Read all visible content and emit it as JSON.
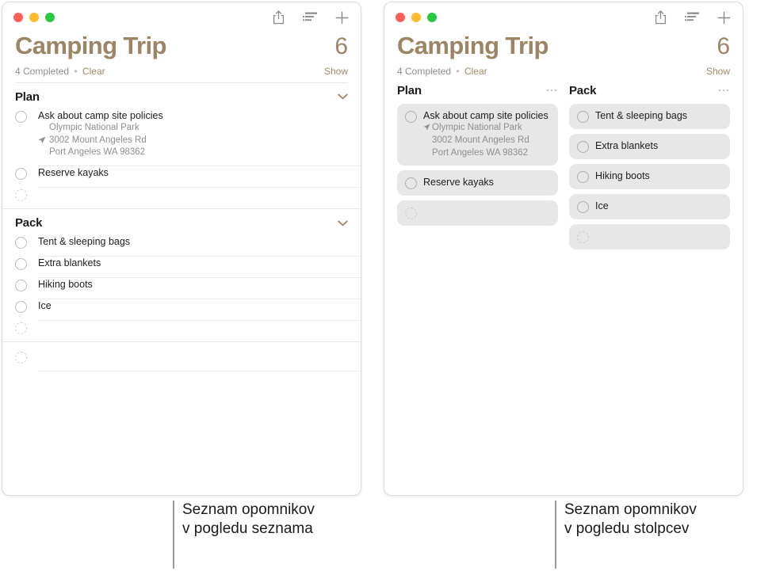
{
  "window_list": {
    "traffic_lights": [
      "close",
      "minimize",
      "zoom"
    ],
    "toolbar": {
      "share_label": "Share",
      "view_label": "List View Options",
      "add_label": "Add Reminder"
    },
    "title": "Camping Trip",
    "count": "6",
    "completed_text": "4 Completed",
    "separator": "•",
    "clear_label": "Clear",
    "show_label": "Show",
    "sections": [
      {
        "name": "Plan",
        "items": [
          {
            "title": "Ask about camp site policies",
            "sub": [
              "Olympic National Park",
              "3002 Mount Angeles Rd",
              "Port Angeles WA 98362"
            ],
            "arrow_on_line": 1
          },
          {
            "title": "Reserve kayaks",
            "sub": []
          },
          {
            "title": "",
            "sub": [],
            "placeholder": true
          }
        ]
      },
      {
        "name": "Pack",
        "items": [
          {
            "title": "Tent & sleeping bags",
            "sub": []
          },
          {
            "title": "Extra blankets",
            "sub": []
          },
          {
            "title": "Hiking boots",
            "sub": []
          },
          {
            "title": "Ice",
            "sub": []
          },
          {
            "title": "",
            "sub": [],
            "placeholder": true
          }
        ]
      }
    ],
    "trailing_placeholder": ""
  },
  "window_columns": {
    "title": "Camping Trip",
    "count": "6",
    "completed_text": "4 Completed",
    "separator": "•",
    "clear_label": "Clear",
    "show_label": "Show",
    "columns": [
      {
        "name": "Plan",
        "menu_label": "More options",
        "cards": [
          {
            "title": "Ask about camp site policies",
            "sub": [
              "Olympic National Park",
              "3002 Mount Angeles Rd",
              "Port Angeles WA 98362"
            ],
            "arrow_on_line": 0
          },
          {
            "title": "Reserve kayaks",
            "sub": []
          },
          {
            "title": "",
            "sub": [],
            "placeholder": true
          }
        ]
      },
      {
        "name": "Pack",
        "menu_label": "More options",
        "cards": [
          {
            "title": "Tent & sleeping bags",
            "sub": []
          },
          {
            "title": "Extra blankets",
            "sub": []
          },
          {
            "title": "Hiking boots",
            "sub": []
          },
          {
            "title": "Ice",
            "sub": []
          },
          {
            "title": "",
            "sub": [],
            "placeholder": true
          }
        ]
      }
    ]
  },
  "captions": {
    "list": "Seznam opomnikov\nv pogledu seznama",
    "columns": "Seznam opomnikov\nv pogledu stolpcev"
  },
  "colors": {
    "accent": "#9d8464",
    "title": "#9d8464",
    "card_bg": "#e7e7e7",
    "text": "#1c1c1e",
    "muted": "#8e8e93",
    "traffic_red": "#ff5f57",
    "traffic_yellow": "#febc2e",
    "traffic_green": "#28c840"
  }
}
